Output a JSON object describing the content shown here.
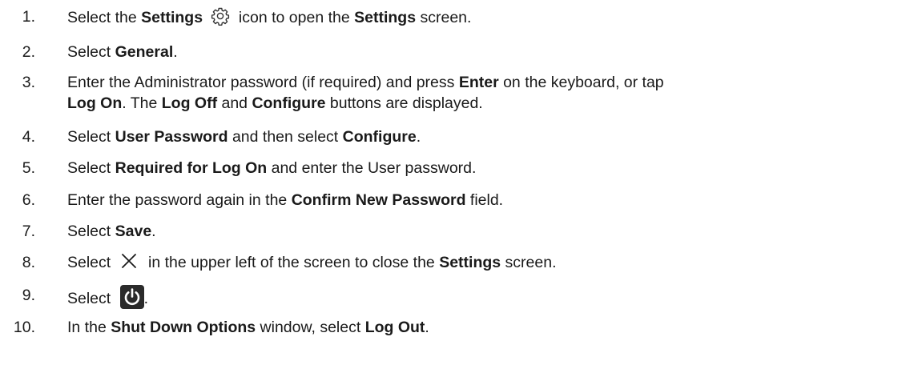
{
  "steps": [
    {
      "num": "1.",
      "parts": [
        "Select the ",
        "Settings",
        " icon to open the ",
        "Settings",
        " screen."
      ],
      "icon": "gear-icon"
    },
    {
      "num": "2.",
      "parts": [
        "Select ",
        "General",
        "."
      ]
    },
    {
      "num": "3.",
      "line1": [
        "Enter the Administrator password (if required) and press ",
        "Enter",
        " on the keyboard, or tap"
      ],
      "line2": [
        "Log On",
        ". The ",
        "Log Off",
        " and ",
        "Configure",
        " buttons are displayed."
      ]
    },
    {
      "num": "4.",
      "parts": [
        "Select ",
        "User Password",
        " and then select ",
        "Configure",
        "."
      ]
    },
    {
      "num": "5.",
      "parts": [
        "Select ",
        "Required for Log On",
        " and enter the User password."
      ]
    },
    {
      "num": "6.",
      "parts": [
        "Enter the password again in the ",
        "Confirm New Password",
        " field."
      ]
    },
    {
      "num": "7.",
      "parts": [
        "Select ",
        "Save",
        "."
      ]
    },
    {
      "num": "8.",
      "parts": [
        "Select ",
        " in the upper left of the screen to close the ",
        "Settings",
        " screen."
      ],
      "icon": "close-x-icon"
    },
    {
      "num": "9.",
      "parts": [
        "Select ",
        "."
      ],
      "icon": "power-icon"
    },
    {
      "num": "10.",
      "parts": [
        "In the ",
        "Shut Down Options",
        " window, select ",
        "Log Out",
        "."
      ]
    }
  ]
}
